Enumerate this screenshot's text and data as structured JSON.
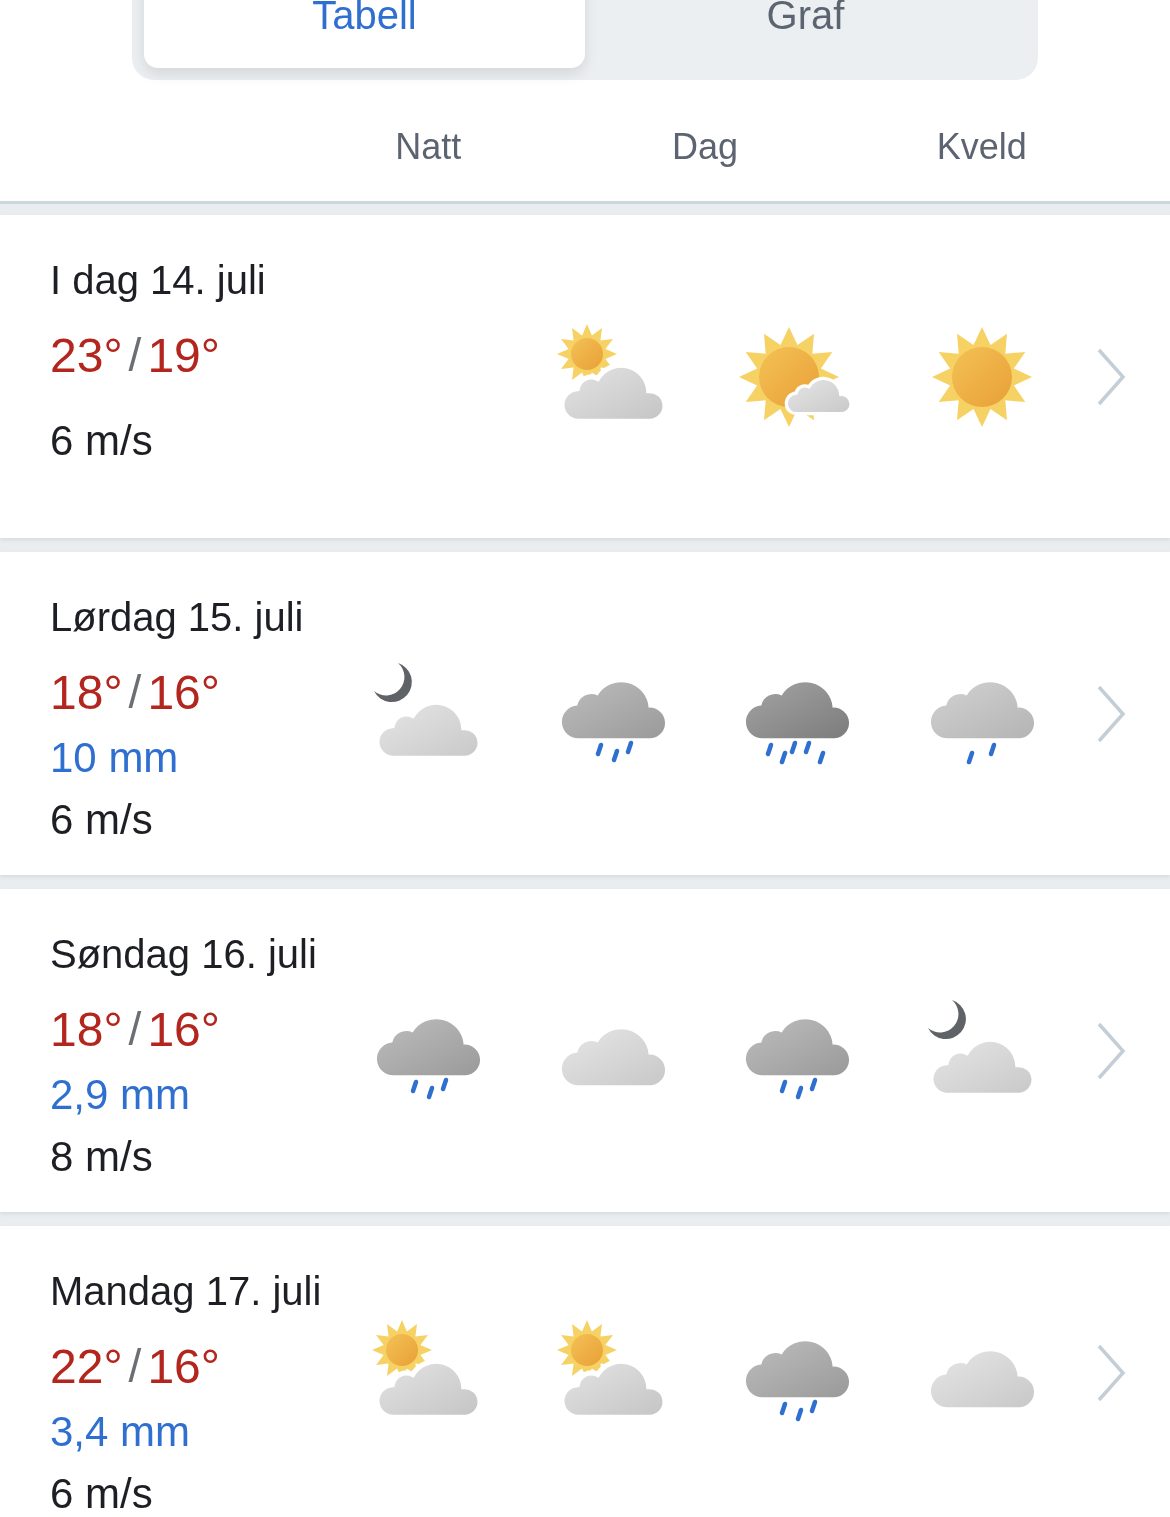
{
  "tabs": [
    {
      "label": "Tabell",
      "selected": true
    },
    {
      "label": "Graf",
      "selected": false
    }
  ],
  "periods": [
    {
      "label": "Natt"
    },
    {
      "label": "Dag"
    },
    {
      "label": "Kveld"
    }
  ],
  "days": [
    {
      "title": "I dag 14. juli",
      "high": "23°",
      "separator": "/",
      "low": "19°",
      "wind": "6 m/s",
      "symbols": [
        {
          "kind": "empty"
        },
        {
          "kind": "partly_cloudy_day"
        },
        {
          "kind": "fair_day"
        },
        {
          "kind": "clear"
        }
      ]
    },
    {
      "title": "Lørdag 15. juli",
      "high": "18°",
      "separator": "/",
      "low": "16°",
      "precipitation": "10 mm",
      "wind": "6 m/s",
      "symbols": [
        {
          "kind": "partly_cloudy_night"
        },
        {
          "kind": "rain"
        },
        {
          "kind": "heavy_rain"
        },
        {
          "kind": "light_rain"
        }
      ]
    },
    {
      "title": "Søndag 16. juli",
      "high": "18°",
      "separator": "/",
      "low": "16°",
      "precipitation": "2,9 mm",
      "wind": "8 m/s",
      "symbols": [
        {
          "kind": "rain"
        },
        {
          "kind": "cloudy"
        },
        {
          "kind": "rain"
        },
        {
          "kind": "partly_cloudy_night"
        }
      ]
    },
    {
      "title": "Mandag 17. juli",
      "high": "22°",
      "separator": "/",
      "low": "16°",
      "precipitation": "3,4 mm",
      "wind": "6 m/s",
      "symbols": [
        {
          "kind": "partly_cloudy_day"
        },
        {
          "kind": "partly_cloudy_day"
        },
        {
          "kind": "rain"
        },
        {
          "kind": "cloudy"
        }
      ]
    }
  ]
}
